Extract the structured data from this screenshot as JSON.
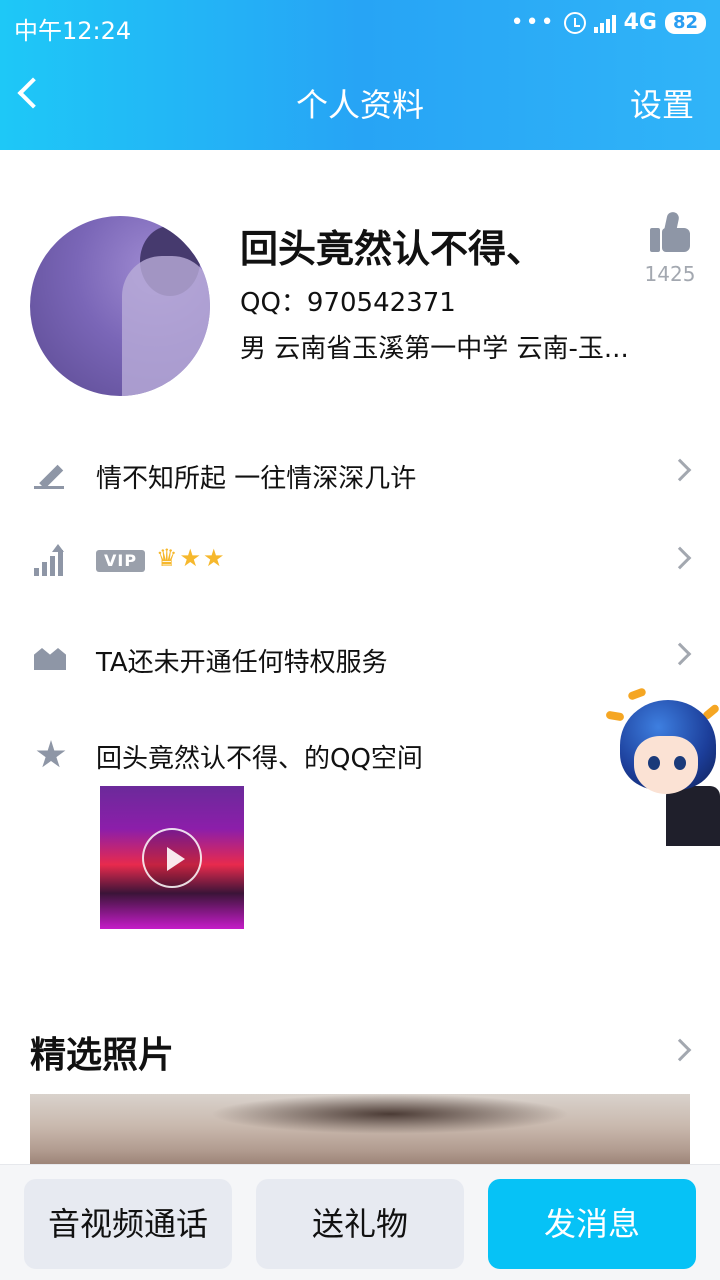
{
  "status_bar": {
    "time": "中午12:24",
    "network": "4G",
    "battery": "82"
  },
  "header": {
    "title": "个人资料",
    "settings_label": "设置"
  },
  "profile": {
    "name": "回头竟然认不得、",
    "qq": "QQ：970542371",
    "info": "男  云南省玉溪第一中学  云南-玉...",
    "likes": "1425"
  },
  "rows": {
    "signature": "情不知所起 一往情深深几许",
    "vip_label": "VIP",
    "stars": "♛★★",
    "privilege": "TA还未开通任何特权服务",
    "qzone": "回头竟然认不得、的QQ空间"
  },
  "photos": {
    "section_title": "精选照片"
  },
  "bottom_bar": {
    "call": "音视频通话",
    "gift": "送礼物",
    "message": "发消息"
  },
  "colors": {
    "header_gradient_start": "#1ec8f7",
    "header_gradient_end": "#30b4f8",
    "primary_button": "#06c2f6",
    "icon_gray": "#8e96a6"
  },
  "icons": {
    "signature": "pencil-icon",
    "level": "level-chart-icon",
    "privilege": "crown-icon",
    "qzone": "qzone-star-icon",
    "like": "thumbs-up-icon"
  }
}
